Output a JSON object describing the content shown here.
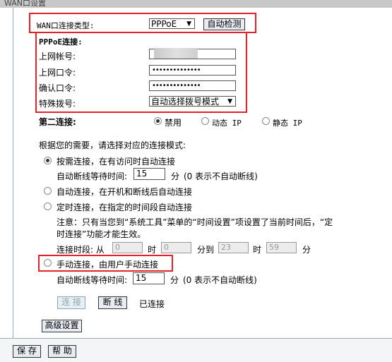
{
  "header": {
    "title": "WAN口设置"
  },
  "wan_type": {
    "label": "WAN口连接类型:",
    "value": "PPPoE",
    "detect_button": "自动检测"
  },
  "pppoe": {
    "heading": "PPPoE连接:",
    "account_label": "上网帐号:",
    "password_label": "上网口令:",
    "password_value": "••••••••••••••",
    "confirm_label": "确认口令:",
    "confirm_value": "••••••••••••••",
    "dial_label": "特殊拨号:",
    "dial_value": "自动选择拨号模式"
  },
  "secondary": {
    "label": "第二连接:",
    "options": [
      "禁用",
      "动态 IP",
      "静态 IP"
    ],
    "selected": 0
  },
  "mode": {
    "intro": "根据您的需要，请选择对应的连接模式:",
    "on_demand": "按需连接，在有访问时自动连接",
    "idle_label": "自动断线等待时间:",
    "idle_value": "15",
    "idle_unit": "分",
    "idle_note": "(0 表示不自动断线)",
    "auto": "自动连接，在开机和断线后自动连接",
    "timed": "定时连接，在指定的时间段自动连接",
    "note_line1": "注意：只有当您到“系统工具”菜单的“时间设置”项设置了当前时间后，“定",
    "note_line2": "时连接”功能才能生效。",
    "period_label": "连接时段: 从",
    "period_from_h": "0",
    "hour_text": "时",
    "period_from_m": "0",
    "to_text": "分到",
    "period_to_h": "23",
    "period_to_m": "59",
    "minute_text": "分",
    "manual": "手动连接，由用户手动连接",
    "manual_idle_label": "自动断线等待时间:",
    "manual_idle_value": "15",
    "manual_idle_unit": "分",
    "manual_idle_note": "(0 表示不自动断线)"
  },
  "actions": {
    "connect": "连 接",
    "disconnect": "断 线",
    "status": "已连接",
    "advanced": "高级设置",
    "save": "保 存",
    "help": "帮 助"
  },
  "colors": {
    "highlight": "#e2232a",
    "footer_bg": "#f3f5f7"
  }
}
